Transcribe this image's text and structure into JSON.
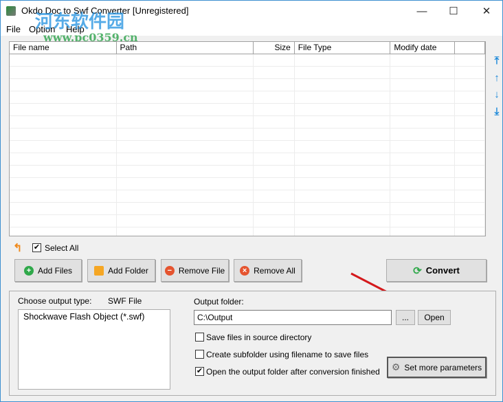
{
  "window": {
    "title": "Okdo Doc to Swf Converter [Unregistered]",
    "minimize": "—",
    "maximize": "☐",
    "close": "✕"
  },
  "watermark": {
    "line1": "河东软件园",
    "line2": "www.pc0359.cn"
  },
  "menu": [
    "File",
    "Option",
    "Help"
  ],
  "table": {
    "columns": [
      "File name",
      "Path",
      "Size",
      "File Type",
      "Modify date",
      ""
    ],
    "rows": []
  },
  "side_icons": [
    "move-top-icon",
    "move-up-icon",
    "move-down-icon",
    "move-bottom-icon"
  ],
  "select_all": {
    "label": "Select All",
    "checked": true
  },
  "buttons": {
    "add_files": "Add Files",
    "add_folder": "Add Folder",
    "remove_file": "Remove File",
    "remove_all": "Remove All",
    "convert": "Convert"
  },
  "output": {
    "type_label": "Choose output type:",
    "type_value": "SWF File",
    "types": [
      "Shockwave Flash Object (*.swf)"
    ],
    "folder_label": "Output folder:",
    "folder_value": "C:\\Output",
    "browse": "...",
    "open": "Open",
    "options": [
      {
        "label": "Save files in source directory",
        "checked": false
      },
      {
        "label": "Create subfolder using filename to save files",
        "checked": false
      },
      {
        "label": "Open the output folder after conversion finished",
        "checked": true
      }
    ],
    "more_params": "Set more parameters"
  }
}
